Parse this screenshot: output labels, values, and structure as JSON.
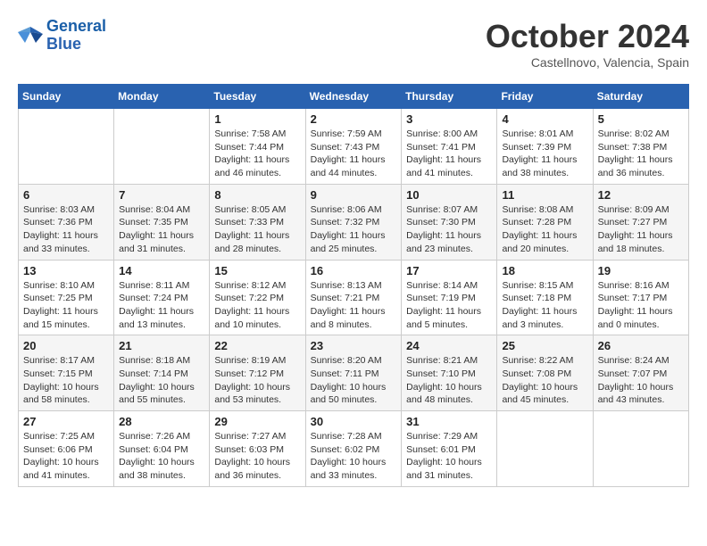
{
  "logo": {
    "text_general": "General",
    "text_blue": "Blue"
  },
  "header": {
    "month": "October 2024",
    "location": "Castellnovo, Valencia, Spain"
  },
  "weekdays": [
    "Sunday",
    "Monday",
    "Tuesday",
    "Wednesday",
    "Thursday",
    "Friday",
    "Saturday"
  ],
  "weeks": [
    [
      null,
      null,
      {
        "day": "1",
        "sunrise": "Sunrise: 7:58 AM",
        "sunset": "Sunset: 7:44 PM",
        "daylight": "Daylight: 11 hours and 46 minutes."
      },
      {
        "day": "2",
        "sunrise": "Sunrise: 7:59 AM",
        "sunset": "Sunset: 7:43 PM",
        "daylight": "Daylight: 11 hours and 44 minutes."
      },
      {
        "day": "3",
        "sunrise": "Sunrise: 8:00 AM",
        "sunset": "Sunset: 7:41 PM",
        "daylight": "Daylight: 11 hours and 41 minutes."
      },
      {
        "day": "4",
        "sunrise": "Sunrise: 8:01 AM",
        "sunset": "Sunset: 7:39 PM",
        "daylight": "Daylight: 11 hours and 38 minutes."
      },
      {
        "day": "5",
        "sunrise": "Sunrise: 8:02 AM",
        "sunset": "Sunset: 7:38 PM",
        "daylight": "Daylight: 11 hours and 36 minutes."
      }
    ],
    [
      {
        "day": "6",
        "sunrise": "Sunrise: 8:03 AM",
        "sunset": "Sunset: 7:36 PM",
        "daylight": "Daylight: 11 hours and 33 minutes."
      },
      {
        "day": "7",
        "sunrise": "Sunrise: 8:04 AM",
        "sunset": "Sunset: 7:35 PM",
        "daylight": "Daylight: 11 hours and 31 minutes."
      },
      {
        "day": "8",
        "sunrise": "Sunrise: 8:05 AM",
        "sunset": "Sunset: 7:33 PM",
        "daylight": "Daylight: 11 hours and 28 minutes."
      },
      {
        "day": "9",
        "sunrise": "Sunrise: 8:06 AM",
        "sunset": "Sunset: 7:32 PM",
        "daylight": "Daylight: 11 hours and 25 minutes."
      },
      {
        "day": "10",
        "sunrise": "Sunrise: 8:07 AM",
        "sunset": "Sunset: 7:30 PM",
        "daylight": "Daylight: 11 hours and 23 minutes."
      },
      {
        "day": "11",
        "sunrise": "Sunrise: 8:08 AM",
        "sunset": "Sunset: 7:28 PM",
        "daylight": "Daylight: 11 hours and 20 minutes."
      },
      {
        "day": "12",
        "sunrise": "Sunrise: 8:09 AM",
        "sunset": "Sunset: 7:27 PM",
        "daylight": "Daylight: 11 hours and 18 minutes."
      }
    ],
    [
      {
        "day": "13",
        "sunrise": "Sunrise: 8:10 AM",
        "sunset": "Sunset: 7:25 PM",
        "daylight": "Daylight: 11 hours and 15 minutes."
      },
      {
        "day": "14",
        "sunrise": "Sunrise: 8:11 AM",
        "sunset": "Sunset: 7:24 PM",
        "daylight": "Daylight: 11 hours and 13 minutes."
      },
      {
        "day": "15",
        "sunrise": "Sunrise: 8:12 AM",
        "sunset": "Sunset: 7:22 PM",
        "daylight": "Daylight: 11 hours and 10 minutes."
      },
      {
        "day": "16",
        "sunrise": "Sunrise: 8:13 AM",
        "sunset": "Sunset: 7:21 PM",
        "daylight": "Daylight: 11 hours and 8 minutes."
      },
      {
        "day": "17",
        "sunrise": "Sunrise: 8:14 AM",
        "sunset": "Sunset: 7:19 PM",
        "daylight": "Daylight: 11 hours and 5 minutes."
      },
      {
        "day": "18",
        "sunrise": "Sunrise: 8:15 AM",
        "sunset": "Sunset: 7:18 PM",
        "daylight": "Daylight: 11 hours and 3 minutes."
      },
      {
        "day": "19",
        "sunrise": "Sunrise: 8:16 AM",
        "sunset": "Sunset: 7:17 PM",
        "daylight": "Daylight: 11 hours and 0 minutes."
      }
    ],
    [
      {
        "day": "20",
        "sunrise": "Sunrise: 8:17 AM",
        "sunset": "Sunset: 7:15 PM",
        "daylight": "Daylight: 10 hours and 58 minutes."
      },
      {
        "day": "21",
        "sunrise": "Sunrise: 8:18 AM",
        "sunset": "Sunset: 7:14 PM",
        "daylight": "Daylight: 10 hours and 55 minutes."
      },
      {
        "day": "22",
        "sunrise": "Sunrise: 8:19 AM",
        "sunset": "Sunset: 7:12 PM",
        "daylight": "Daylight: 10 hours and 53 minutes."
      },
      {
        "day": "23",
        "sunrise": "Sunrise: 8:20 AM",
        "sunset": "Sunset: 7:11 PM",
        "daylight": "Daylight: 10 hours and 50 minutes."
      },
      {
        "day": "24",
        "sunrise": "Sunrise: 8:21 AM",
        "sunset": "Sunset: 7:10 PM",
        "daylight": "Daylight: 10 hours and 48 minutes."
      },
      {
        "day": "25",
        "sunrise": "Sunrise: 8:22 AM",
        "sunset": "Sunset: 7:08 PM",
        "daylight": "Daylight: 10 hours and 45 minutes."
      },
      {
        "day": "26",
        "sunrise": "Sunrise: 8:24 AM",
        "sunset": "Sunset: 7:07 PM",
        "daylight": "Daylight: 10 hours and 43 minutes."
      }
    ],
    [
      {
        "day": "27",
        "sunrise": "Sunrise: 7:25 AM",
        "sunset": "Sunset: 6:06 PM",
        "daylight": "Daylight: 10 hours and 41 minutes."
      },
      {
        "day": "28",
        "sunrise": "Sunrise: 7:26 AM",
        "sunset": "Sunset: 6:04 PM",
        "daylight": "Daylight: 10 hours and 38 minutes."
      },
      {
        "day": "29",
        "sunrise": "Sunrise: 7:27 AM",
        "sunset": "Sunset: 6:03 PM",
        "daylight": "Daylight: 10 hours and 36 minutes."
      },
      {
        "day": "30",
        "sunrise": "Sunrise: 7:28 AM",
        "sunset": "Sunset: 6:02 PM",
        "daylight": "Daylight: 10 hours and 33 minutes."
      },
      {
        "day": "31",
        "sunrise": "Sunrise: 7:29 AM",
        "sunset": "Sunset: 6:01 PM",
        "daylight": "Daylight: 10 hours and 31 minutes."
      },
      null,
      null
    ]
  ]
}
